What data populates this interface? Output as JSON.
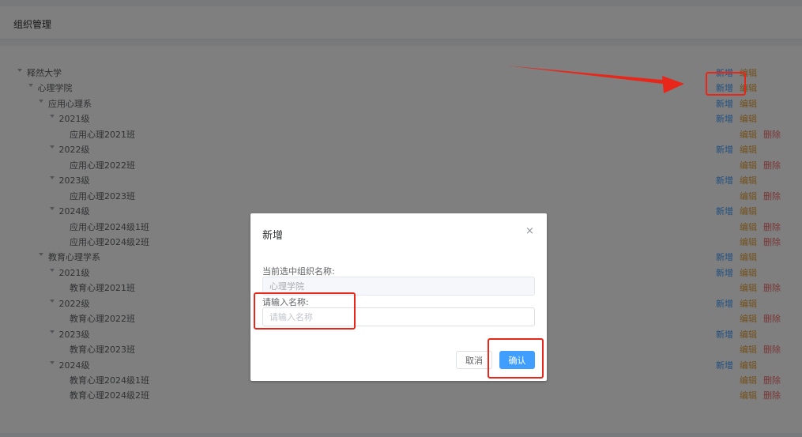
{
  "header": {
    "title": "组织管理"
  },
  "actions": {
    "add": "新增",
    "edit": "编辑",
    "delete": "删除"
  },
  "tree": [
    {
      "label": "释然大学",
      "level": 0,
      "expandable": true,
      "actions": [
        "add",
        "edit"
      ]
    },
    {
      "label": "心理学院",
      "level": 1,
      "expandable": true,
      "actions": [
        "add",
        "edit"
      ]
    },
    {
      "label": "应用心理系",
      "level": 2,
      "expandable": true,
      "actions": [
        "add",
        "edit"
      ]
    },
    {
      "label": "2021级",
      "level": 3,
      "expandable": true,
      "actions": [
        "add",
        "edit"
      ]
    },
    {
      "label": "应用心理2021班",
      "level": 4,
      "expandable": false,
      "actions": [
        "edit",
        "delete"
      ]
    },
    {
      "label": "2022级",
      "level": 3,
      "expandable": true,
      "actions": [
        "add",
        "edit"
      ]
    },
    {
      "label": "应用心理2022班",
      "level": 4,
      "expandable": false,
      "actions": [
        "edit",
        "delete"
      ]
    },
    {
      "label": "2023级",
      "level": 3,
      "expandable": true,
      "actions": [
        "add",
        "edit"
      ]
    },
    {
      "label": "应用心理2023班",
      "level": 4,
      "expandable": false,
      "actions": [
        "edit",
        "delete"
      ]
    },
    {
      "label": "2024级",
      "level": 3,
      "expandable": true,
      "actions": [
        "add",
        "edit"
      ]
    },
    {
      "label": "应用心理2024级1班",
      "level": 4,
      "expandable": false,
      "actions": [
        "edit",
        "delete"
      ]
    },
    {
      "label": "应用心理2024级2班",
      "level": 4,
      "expandable": false,
      "actions": [
        "edit",
        "delete"
      ]
    },
    {
      "label": "教育心理学系",
      "level": 2,
      "expandable": true,
      "actions": [
        "add",
        "edit"
      ]
    },
    {
      "label": "2021级",
      "level": 3,
      "expandable": true,
      "actions": [
        "add",
        "edit"
      ]
    },
    {
      "label": "教育心理2021班",
      "level": 4,
      "expandable": false,
      "actions": [
        "edit",
        "delete"
      ]
    },
    {
      "label": "2022级",
      "level": 3,
      "expandable": true,
      "actions": [
        "add",
        "edit"
      ]
    },
    {
      "label": "教育心理2022班",
      "level": 4,
      "expandable": false,
      "actions": [
        "edit",
        "delete"
      ]
    },
    {
      "label": "2023级",
      "level": 3,
      "expandable": true,
      "actions": [
        "add",
        "edit"
      ]
    },
    {
      "label": "教育心理2023班",
      "level": 4,
      "expandable": false,
      "actions": [
        "edit",
        "delete"
      ]
    },
    {
      "label": "2024级",
      "level": 3,
      "expandable": true,
      "actions": [
        "add",
        "edit"
      ]
    },
    {
      "label": "教育心理2024级1班",
      "level": 4,
      "expandable": false,
      "actions": [
        "edit",
        "delete"
      ]
    },
    {
      "label": "教育心理2024级2班",
      "level": 4,
      "expandable": false,
      "actions": [
        "edit",
        "delete"
      ]
    }
  ],
  "dialog": {
    "title": "新增",
    "close_glyph": "×",
    "current_label": "当前选中组织名称:",
    "current_value": "心理学院",
    "name_label": "请输入名称:",
    "name_placeholder": "请输入名称",
    "cancel": "取消",
    "confirm": "确认"
  },
  "colors": {
    "link_add": "#409eff",
    "link_edit": "#e6a23c",
    "link_delete": "#f56c6c",
    "primary": "#409eff",
    "annotation": "#e8261a"
  }
}
